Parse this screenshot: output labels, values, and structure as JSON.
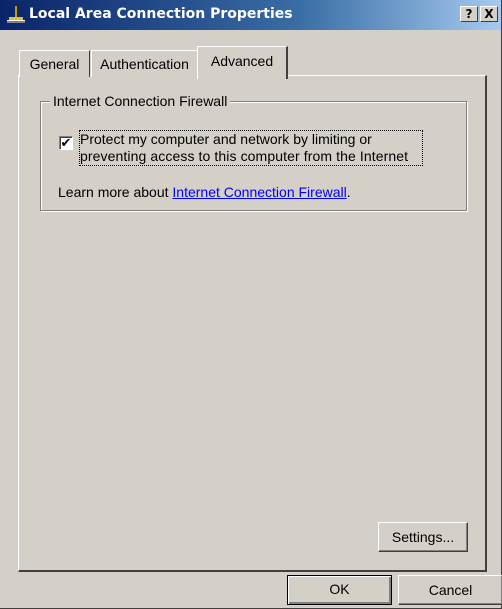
{
  "window": {
    "title": "Local Area Connection Properties",
    "help_label": "?",
    "close_label": "X"
  },
  "tabs": [
    {
      "label": "General",
      "selected": false
    },
    {
      "label": "Authentication",
      "selected": false
    },
    {
      "label": "Advanced",
      "selected": true
    }
  ],
  "firewall": {
    "group_title": "Internet Connection Firewall",
    "checkbox_checked": true,
    "checkbox_mark": "✔",
    "checkbox_label_line1": "Protect my computer and network by limiting or",
    "checkbox_label_line2": "preventing access to this computer from the Internet",
    "learn_prefix": "Learn more about ",
    "learn_link": "Internet Connection Firewall",
    "learn_suffix": "."
  },
  "buttons": {
    "settings": "Settings...",
    "ok": "OK",
    "cancel": "Cancel"
  },
  "colors": {
    "titlebar_start": "#0a246a",
    "titlebar_end": "#a6caf0",
    "dialog_face": "#d4d0c8",
    "link": "#0000ff"
  },
  "icons": {
    "title_icon": "network-connection-icon"
  }
}
